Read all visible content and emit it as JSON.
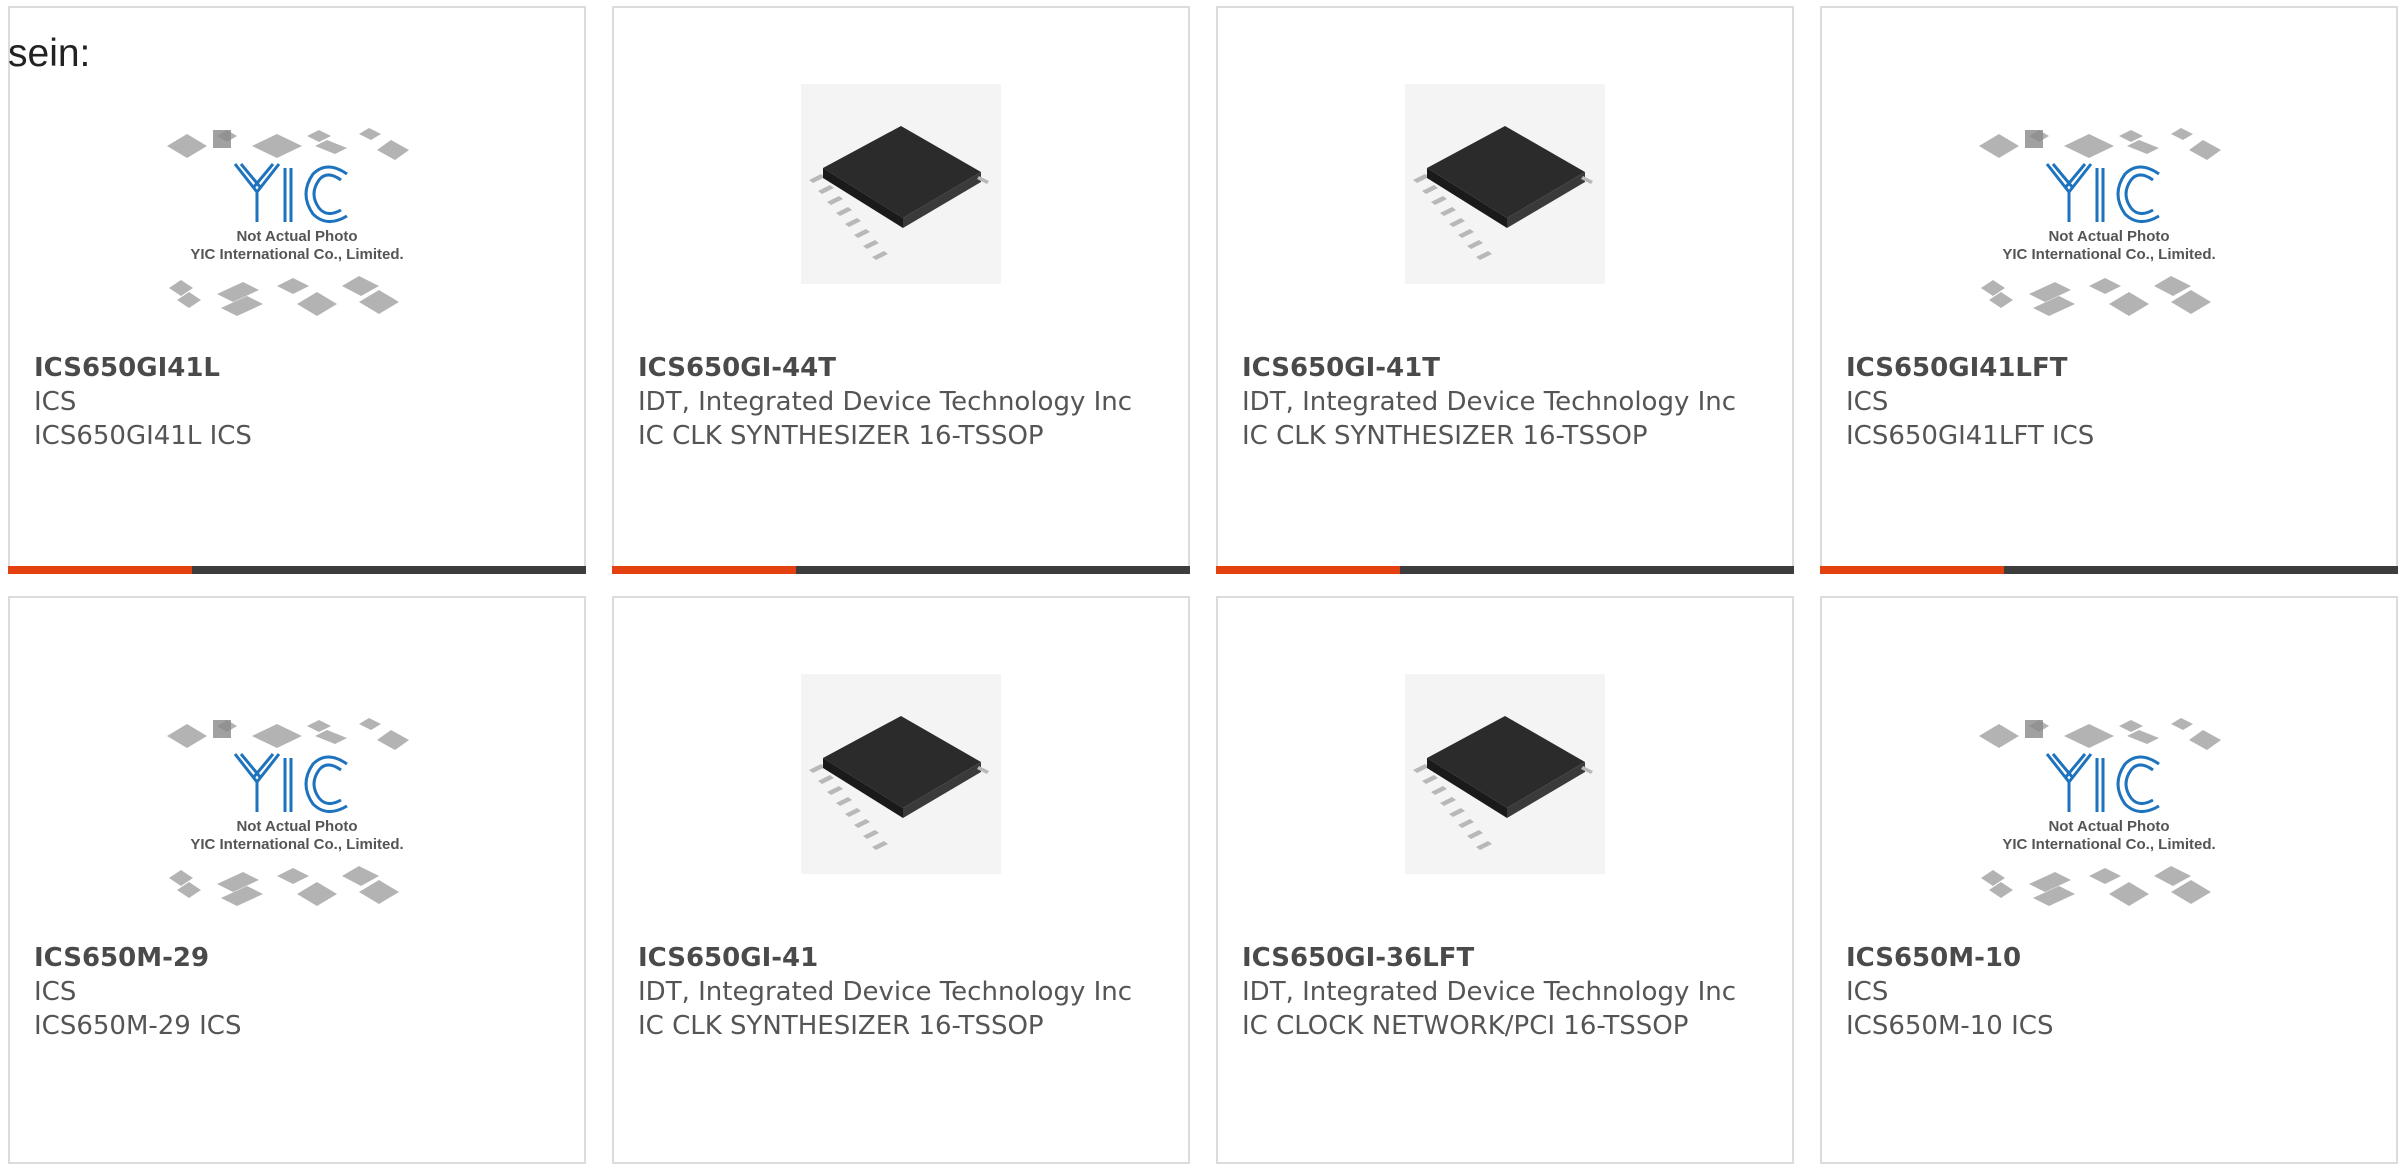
{
  "page": {
    "intro_text": "sein:"
  },
  "placeholder_image": {
    "line1": "Not Actual Photo",
    "line2": "YIC International Co., Limited."
  },
  "colors": {
    "accent": "#e5400f",
    "bar": "#3d3d3d",
    "border": "#dcdcdc",
    "text": "#555555",
    "logo_blue": "#1e73be"
  },
  "products": [
    {
      "part": "ICS650GI41L",
      "manufacturer": "ICS",
      "description": "ICS650GI41L ICS",
      "image": "placeholder-image"
    },
    {
      "part": "ICS650GI-44T",
      "manufacturer": "IDT, Integrated Device Technology Inc",
      "description": "IC CLK SYNTHESIZER 16-TSSOP",
      "image": "chip-image"
    },
    {
      "part": "ICS650GI-41T",
      "manufacturer": "IDT, Integrated Device Technology Inc",
      "description": "IC CLK SYNTHESIZER 16-TSSOP",
      "image": "chip-image"
    },
    {
      "part": "ICS650GI41LFT",
      "manufacturer": "ICS",
      "description": "ICS650GI41LFT ICS",
      "image": "placeholder-image"
    },
    {
      "part": "ICS650M-29",
      "manufacturer": "ICS",
      "description": "ICS650M-29 ICS",
      "image": "placeholder-image"
    },
    {
      "part": "ICS650GI-41",
      "manufacturer": "IDT, Integrated Device Technology Inc",
      "description": "IC CLK SYNTHESIZER 16-TSSOP",
      "image": "chip-image"
    },
    {
      "part": "ICS650GI-36LFT",
      "manufacturer": "IDT, Integrated Device Technology Inc",
      "description": "IC CLOCK NETWORK/PCI 16-TSSOP",
      "image": "chip-image"
    },
    {
      "part": "ICS650M-10",
      "manufacturer": "ICS",
      "description": "ICS650M-10 ICS",
      "image": "placeholder-image"
    }
  ]
}
